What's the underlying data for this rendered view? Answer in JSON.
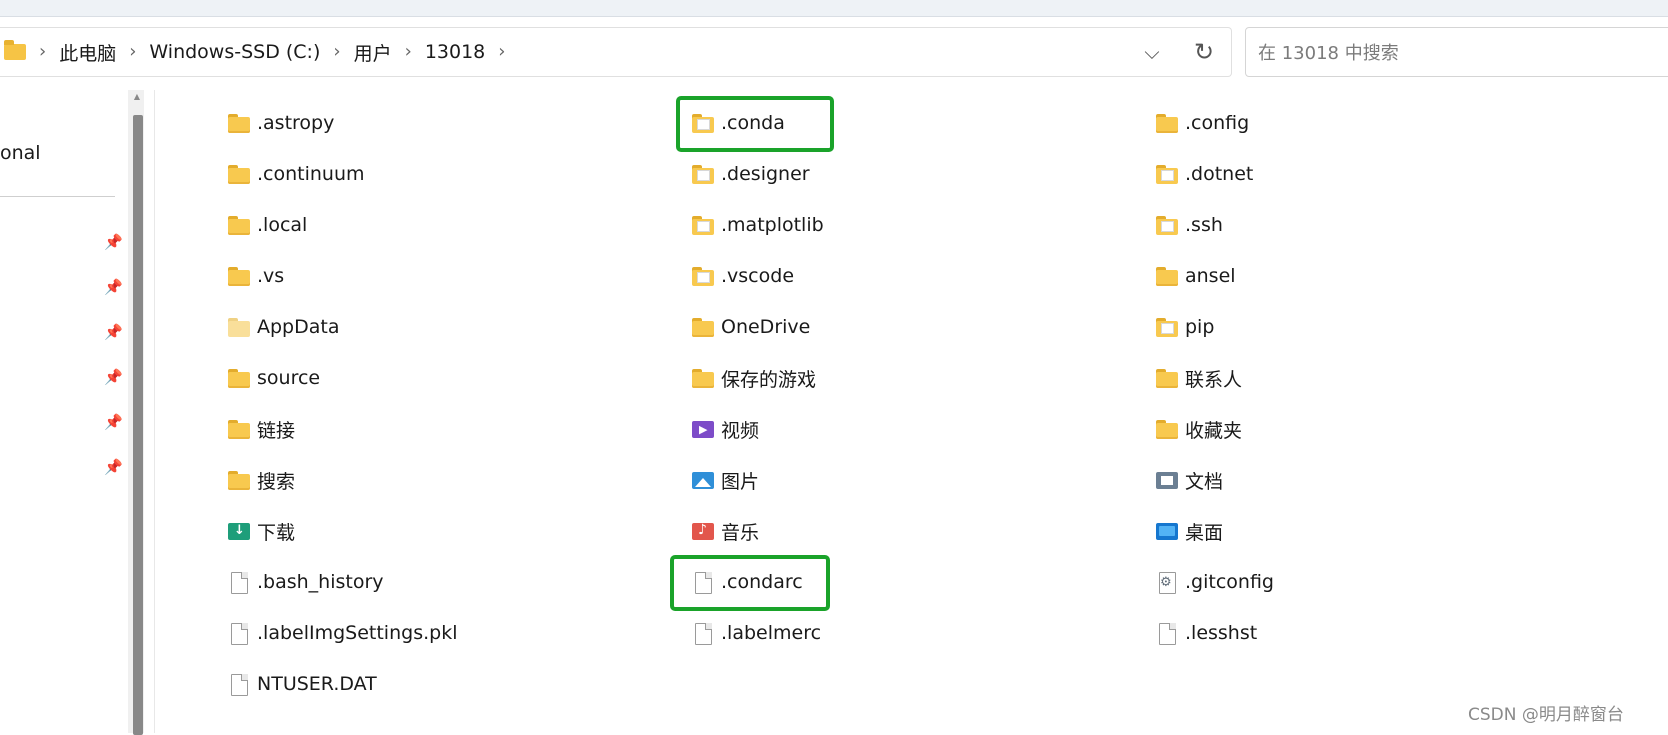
{
  "breadcrumb": {
    "items": [
      "此电脑",
      "Windows-SSD (C:)",
      "用户",
      "13018"
    ]
  },
  "search": {
    "placeholder": "在 13018 中搜索"
  },
  "nav": {
    "partial_label": "onal"
  },
  "files": {
    "col1": [
      {
        "name": ".astropy",
        "icon": "folder-icon"
      },
      {
        "name": ".continuum",
        "icon": "folder-icon"
      },
      {
        "name": ".local",
        "icon": "folder-icon"
      },
      {
        "name": ".vs",
        "icon": "folder-icon"
      },
      {
        "name": "AppData",
        "icon": "folder-hidden-icon"
      },
      {
        "name": "source",
        "icon": "folder-icon"
      },
      {
        "name": "链接",
        "icon": "folder-icon"
      },
      {
        "name": "搜索",
        "icon": "folder-icon"
      },
      {
        "name": "下载",
        "icon": "download-folder-icon"
      },
      {
        "name": ".bash_history",
        "icon": "file-icon"
      },
      {
        "name": ".labelImgSettings.pkl",
        "icon": "file-icon"
      },
      {
        "name": "NTUSER.DAT",
        "icon": "file-icon"
      }
    ],
    "col2": [
      {
        "name": ".conda",
        "icon": "folder-doc-icon"
      },
      {
        "name": ".designer",
        "icon": "folder-doc-icon"
      },
      {
        "name": ".matplotlib",
        "icon": "folder-doc-icon"
      },
      {
        "name": ".vscode",
        "icon": "folder-doc-icon"
      },
      {
        "name": "OneDrive",
        "icon": "folder-icon"
      },
      {
        "name": "保存的游戏",
        "icon": "folder-icon"
      },
      {
        "name": "视频",
        "icon": "video-folder-icon"
      },
      {
        "name": "图片",
        "icon": "picture-folder-icon"
      },
      {
        "name": "音乐",
        "icon": "music-folder-icon"
      },
      {
        "name": ".condarc",
        "icon": "file-icon"
      },
      {
        "name": ".labelmerc",
        "icon": "file-icon"
      }
    ],
    "col3": [
      {
        "name": ".config",
        "icon": "folder-icon"
      },
      {
        "name": ".dotnet",
        "icon": "folder-doc-icon"
      },
      {
        "name": ".ssh",
        "icon": "folder-doc-icon"
      },
      {
        "name": "ansel",
        "icon": "folder-icon"
      },
      {
        "name": "pip",
        "icon": "folder-doc-icon"
      },
      {
        "name": "联系人",
        "icon": "folder-icon"
      },
      {
        "name": "收藏夹",
        "icon": "folder-icon"
      },
      {
        "name": "文档",
        "icon": "documents-folder-icon"
      },
      {
        "name": "桌面",
        "icon": "desktop-folder-icon"
      },
      {
        "name": ".gitconfig",
        "icon": "config-file-icon"
      },
      {
        "name": ".lesshst",
        "icon": "file-icon"
      }
    ]
  },
  "highlight_color": "#1aa32a",
  "watermark": "CSDN @明月醉窗台"
}
